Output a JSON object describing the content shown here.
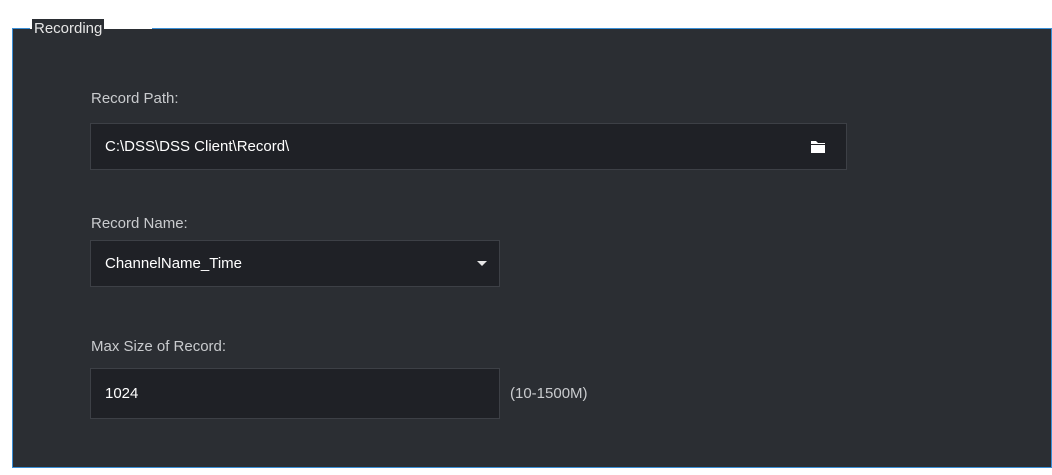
{
  "group": {
    "title": "Recording"
  },
  "record_path": {
    "label": "Record Path:",
    "value": "C:\\DSS\\DSS Client\\Record\\",
    "browse_icon": "folder-icon"
  },
  "record_name": {
    "label": "Record Name:",
    "selected": "ChannelName_Time"
  },
  "max_size": {
    "label": "Max Size of Record:",
    "value": "1024",
    "range_hint": "(10-1500M)"
  },
  "colors": {
    "panel_bg": "#2b2e33",
    "field_bg": "#1f2126",
    "border_accent": "#3a8fd6",
    "text": "#e6e6e6"
  }
}
